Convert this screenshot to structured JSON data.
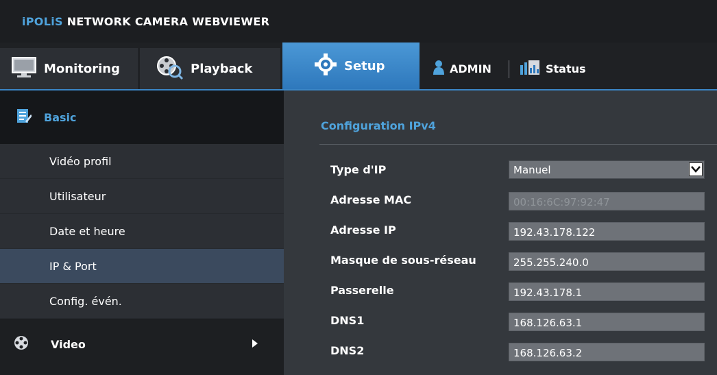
{
  "app": {
    "title_brand": "iPOLiS",
    "title_rest": " NETWORK CAMERA WEBVIEWER"
  },
  "nav": {
    "monitoring": "Monitoring",
    "playback": "Playback",
    "setup": "Setup",
    "admin": "ADMIN",
    "status": "Status",
    "active_tab": "Setup"
  },
  "sidebar": {
    "section": "Basic",
    "items": [
      {
        "label": "Vidéo profil"
      },
      {
        "label": "Utilisateur"
      },
      {
        "label": "Date et heure"
      },
      {
        "label": "IP & Port"
      },
      {
        "label": "Config. évén."
      }
    ],
    "active_item": "IP & Port",
    "video": "Video"
  },
  "main": {
    "section_title": "Configuration IPv4",
    "fields": {
      "ip_type": {
        "label": "Type d'IP",
        "value": "Manuel"
      },
      "mac": {
        "label": "Adresse MAC",
        "value": "00:16:6C:97:92:47"
      },
      "ip": {
        "label": "Adresse IP",
        "value": "192.43.178.122"
      },
      "mask": {
        "label": "Masque de sous-réseau",
        "value": "255.255.240.0"
      },
      "gateway": {
        "label": "Passerelle",
        "value": "192.43.178.1"
      },
      "dns1": {
        "label": "DNS1",
        "value": "168.126.63.1"
      },
      "dns2": {
        "label": "DNS2",
        "value": "168.126.63.2"
      }
    }
  },
  "colors": {
    "accent": "#4fa3dc",
    "setup_tab": "#3b86c6",
    "active_item_bg": "#3b4a5e"
  }
}
